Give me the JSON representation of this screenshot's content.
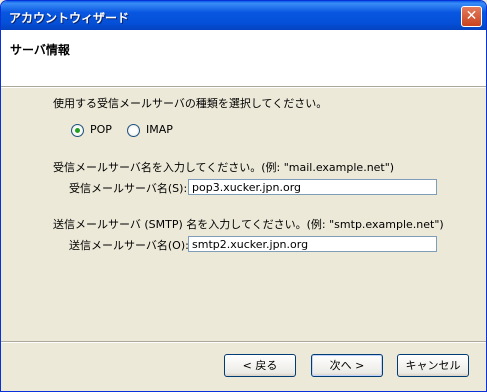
{
  "window": {
    "title": "アカウントウィザード",
    "close_glyph": "✕"
  },
  "header": {
    "title": "サーバ情報"
  },
  "content": {
    "instruction": "使用する受信メールサーバの種類を選択してください。",
    "server_type": {
      "options": [
        {
          "label": "POP",
          "checked": true
        },
        {
          "label": "IMAP",
          "checked": false
        }
      ]
    },
    "incoming": {
      "prompt": "受信メールサーバ名を入力してください。(例: \"mail.example.net\")",
      "label": "受信メールサーバ名(S):",
      "value": "pop3.xucker.jpn.org"
    },
    "outgoing": {
      "prompt": "送信メールサーバ (SMTP) 名を入力してください。(例: \"smtp.example.net\")",
      "label": "送信メールサーバ名(O):",
      "value": "smtp2.xucker.jpn.org"
    }
  },
  "footer": {
    "back_label": "< 戻る",
    "next_label": "次へ >",
    "cancel_label": "キャンセル"
  }
}
